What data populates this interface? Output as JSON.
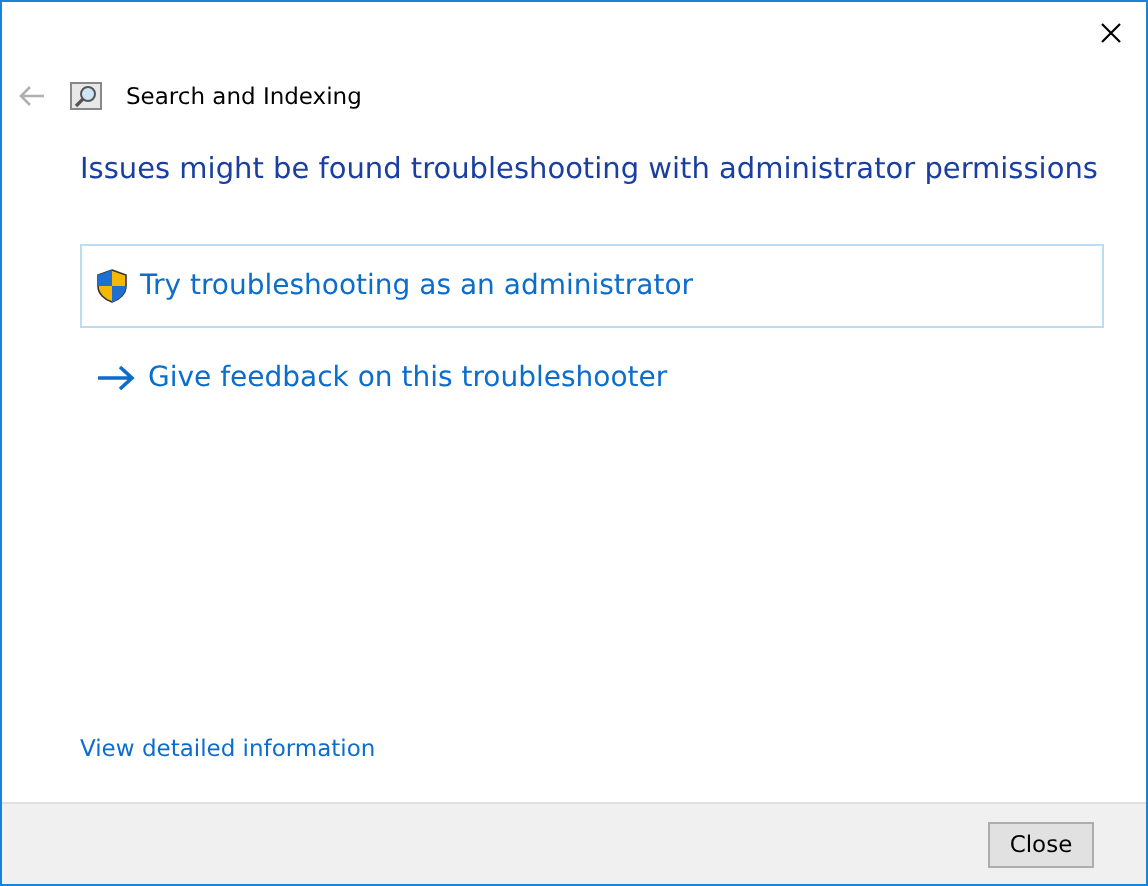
{
  "window": {
    "title": "Search and Indexing"
  },
  "heading": "Issues might be found troubleshooting with administrator permissions",
  "options": [
    {
      "kind": "shield",
      "label": "Try troubleshooting as an administrator"
    },
    {
      "kind": "arrow",
      "label": "Give feedback on this troubleshooter"
    }
  ],
  "details_link": "View detailed information",
  "buttons": [
    "Close"
  ]
}
